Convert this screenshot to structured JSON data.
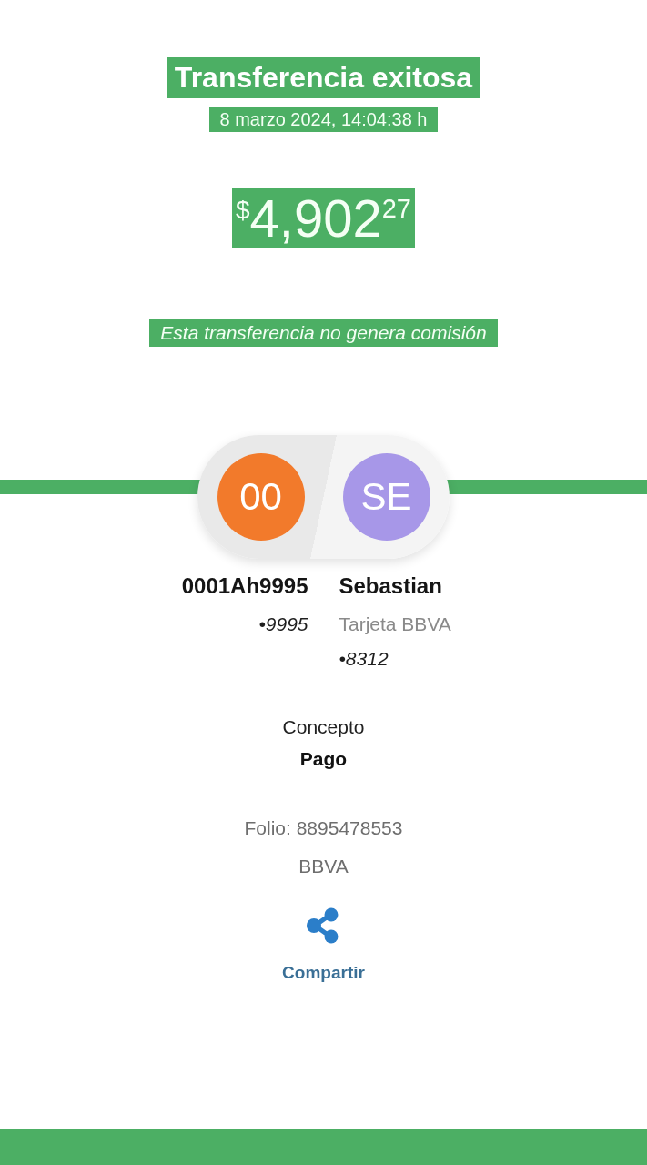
{
  "header": {
    "title": "Transferencia exitosa",
    "datetime": "8 marzo 2024, 14:04:38 h"
  },
  "amount": {
    "currency": "$",
    "integer": "4,902",
    "cents": "27"
  },
  "commission_note": "Esta transferencia no genera comisión",
  "participants": [
    {
      "initials": "00",
      "color": "#f27a2b",
      "name": "0001Ah9995",
      "details": [
        {
          "kind": "account",
          "text": "•9995"
        }
      ]
    },
    {
      "initials": "SE",
      "color": "#a797e8",
      "name": "Sebastian",
      "details": [
        {
          "kind": "bank",
          "text": "Tarjeta BBVA"
        },
        {
          "kind": "account",
          "text": "•8312"
        }
      ]
    }
  ],
  "concept": {
    "label": "Concepto",
    "value": "Pago"
  },
  "folio": "Folio: 8895478553",
  "bank": "BBVA",
  "share": {
    "label": "Compartir"
  }
}
